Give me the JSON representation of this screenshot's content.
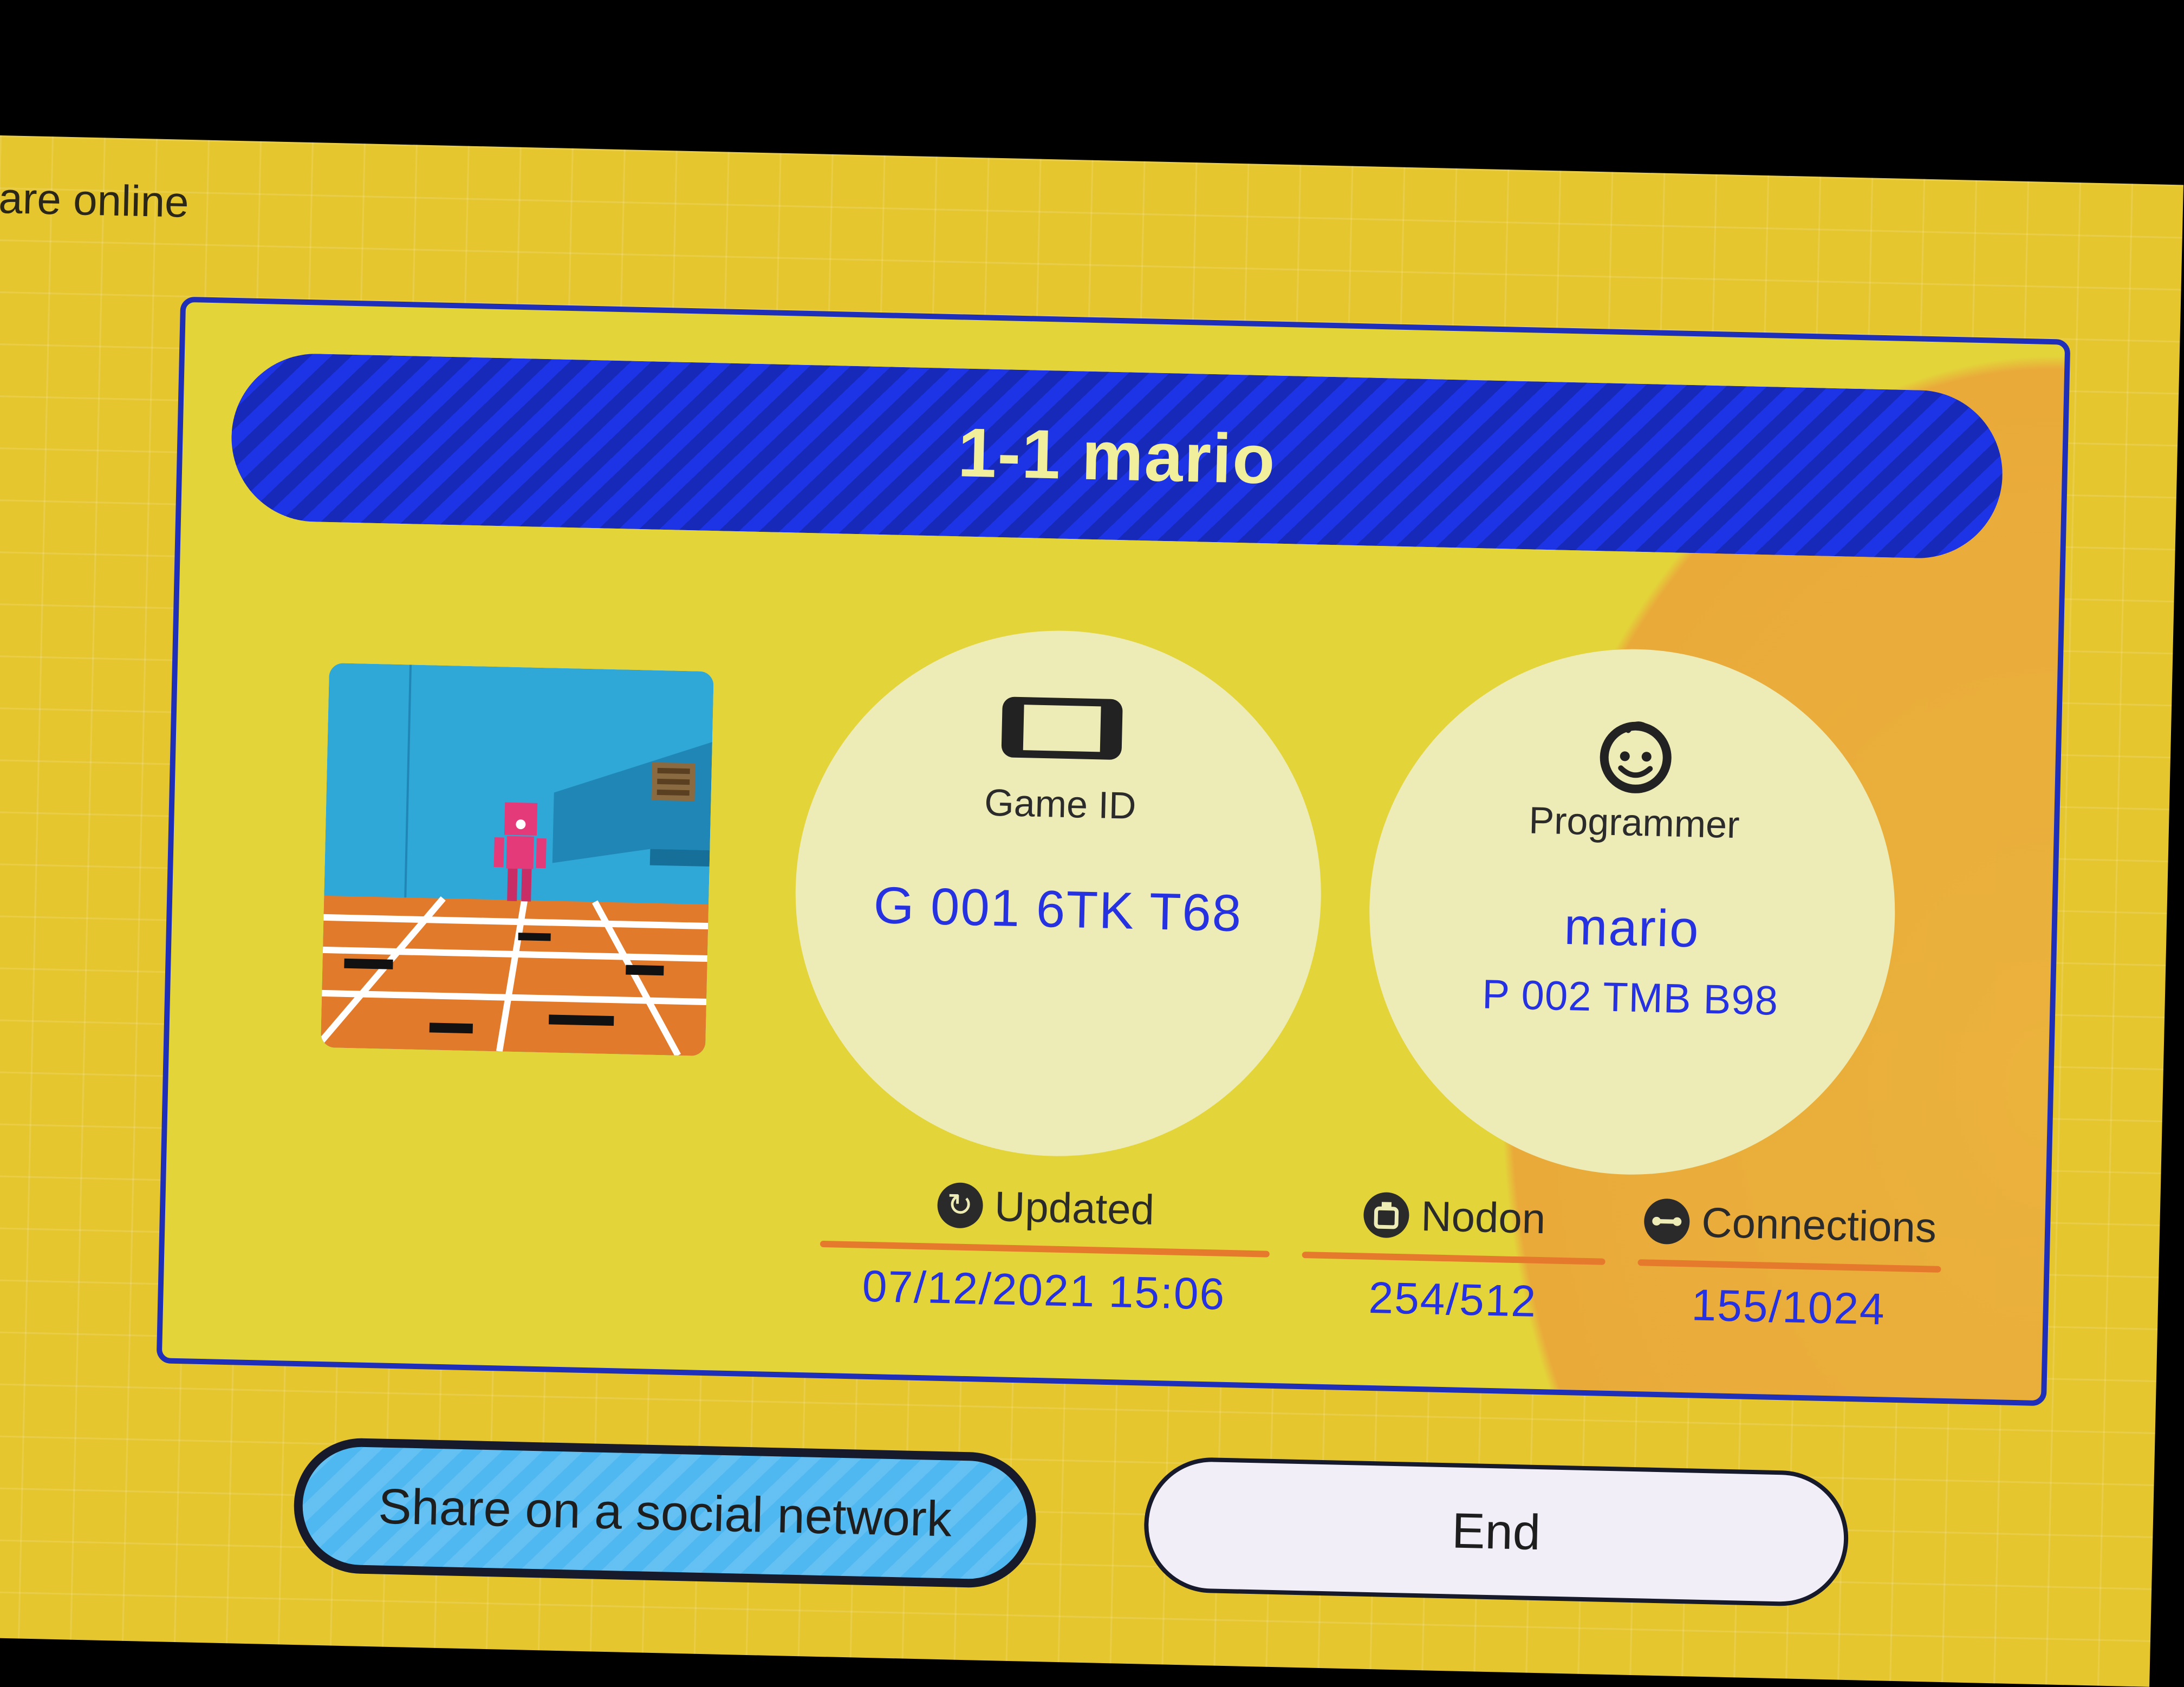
{
  "header": {
    "status_text": "are online"
  },
  "game": {
    "title": "1-1 mario",
    "game_id_label": "Game ID",
    "game_id_value": "G 001 6TK T68",
    "programmer_label": "Programmer",
    "programmer_name": "mario",
    "programmer_id": "P 002 TMB B98",
    "thumbnail_icon": "game-screenshot"
  },
  "stats": {
    "updated_label": "Updated",
    "updated_value": "07/12/2021 15:06",
    "nodon_label": "Nodon",
    "nodon_value": "254/512",
    "connections_label": "Connections",
    "connections_value": "155/1024"
  },
  "buttons": {
    "share_label": "Share on a social network",
    "end_label": "End"
  },
  "colors": {
    "background": "#e6c62e",
    "accent_blue": "#1d34e6",
    "value_blue": "#2631e0",
    "share_button": "#4fb8f0",
    "rule_orange": "#e67a2c"
  }
}
